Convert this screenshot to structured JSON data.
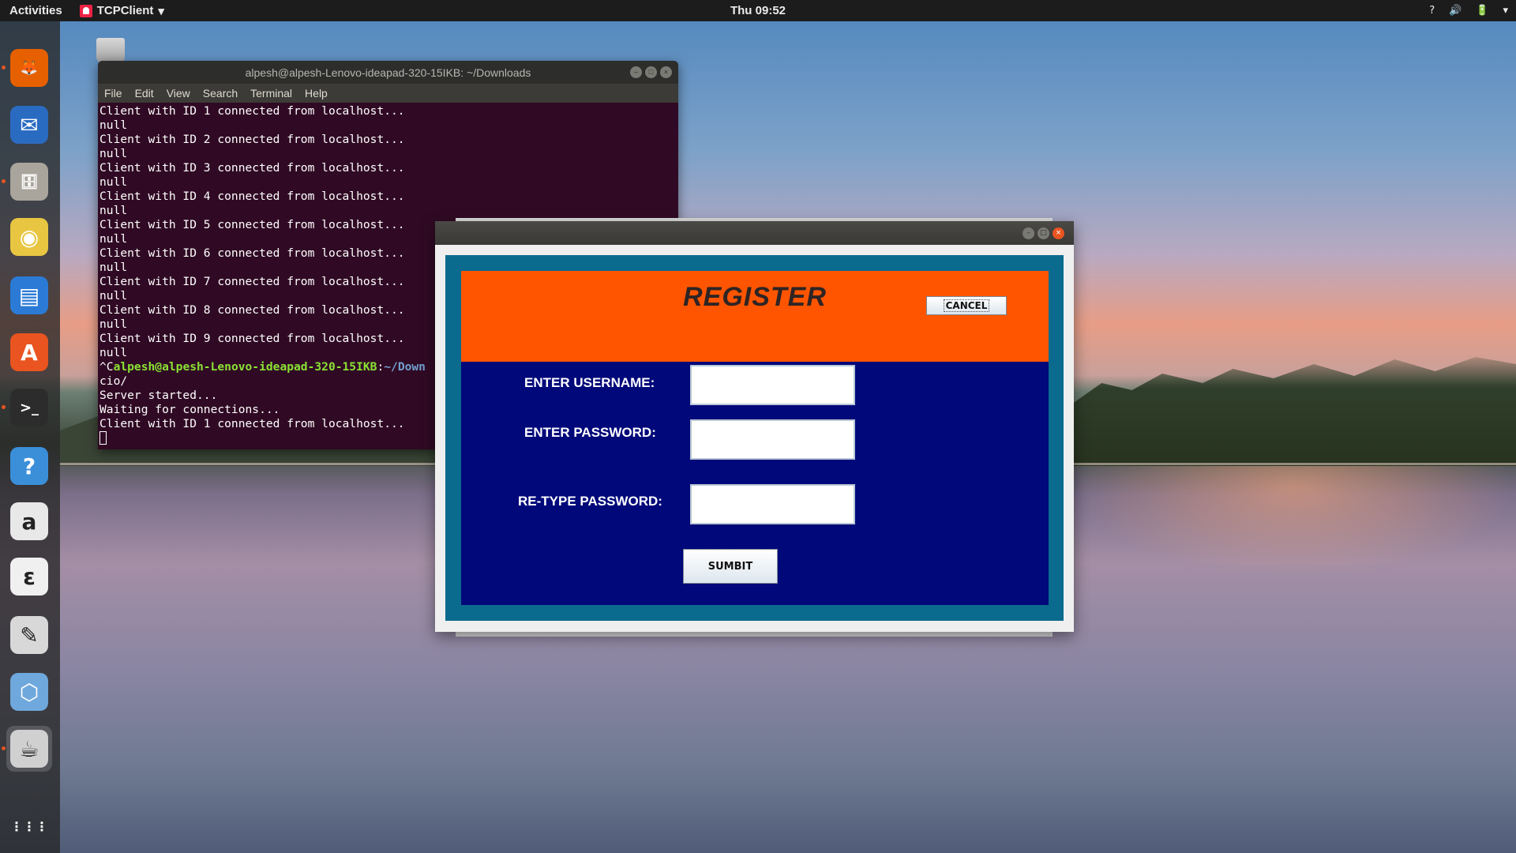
{
  "topbar": {
    "activities": "Activities",
    "app_name": "TCPClient",
    "app_menu_arrow": "▾",
    "clock": "Thu 09:52",
    "status_icons": [
      "?",
      "🔊",
      "🔋",
      "▾"
    ]
  },
  "dock": {
    "items": [
      {
        "name": "firefox-icon",
        "glyph": "🦊",
        "bg": "#e66000"
      },
      {
        "name": "thunderbird-icon",
        "glyph": "✉",
        "bg": "#2a6bc2"
      },
      {
        "name": "files-icon",
        "glyph": "🗄",
        "bg": "#a9a59c"
      },
      {
        "name": "rhythmbox-icon",
        "glyph": "◉",
        "bg": "#e8c642"
      },
      {
        "name": "libreoffice-writer-icon",
        "glyph": "▤",
        "bg": "#2b7bd6"
      },
      {
        "name": "software-center-icon",
        "glyph": "A",
        "bg": "#e95420"
      },
      {
        "name": "terminal-icon",
        "glyph": ">_",
        "bg": "#2c2c2c"
      },
      {
        "name": "help-icon",
        "glyph": "?",
        "bg": "#3b8fd9"
      },
      {
        "name": "amazon-icon",
        "glyph": "a",
        "bg": "#e8e8e8"
      },
      {
        "name": "acrobat-reader-icon",
        "glyph": "ε",
        "bg": "#f0f0f0"
      },
      {
        "name": "text-editor-icon",
        "glyph": "✎",
        "bg": "#d8d8d8"
      },
      {
        "name": "virtualbox-icon",
        "glyph": "⬡",
        "bg": "#6fa8dc"
      },
      {
        "name": "java-app-icon",
        "glyph": "☕",
        "bg": "#d0d0d0"
      }
    ],
    "show_apps_glyph": "⋮⋮⋮"
  },
  "terminal": {
    "title": "alpesh@alpesh-Lenovo-ideapad-320-15IKB: ~/Downloads",
    "menu": [
      "File",
      "Edit",
      "View",
      "Search",
      "Terminal",
      "Help"
    ],
    "lines_before_prompt": [
      "Client with ID 1 connected from localhost...",
      "null",
      "Client with ID 2 connected from localhost...",
      "null",
      "Client with ID 3 connected from localhost...",
      "null",
      "Client with ID 4 connected from localhost...",
      "null",
      "Client with ID 5 connected from localhost...",
      "null",
      "Client with ID 6 connected from localhost...",
      "null",
      "Client with ID 7 connected from localhost...",
      "null",
      "Client with ID 8 connected from localhost...",
      "null",
      "Client with ID 9 connected from localhost...",
      "null"
    ],
    "prompt_prefix": "^C",
    "prompt_user": "alpesh@alpesh-Lenovo-ideapad-320-15IKB",
    "prompt_sep": ":",
    "prompt_path": "~/Down",
    "lines_after_prompt": [
      "cio/",
      "Server started...",
      "Waiting for connections...",
      "Client with ID 1 connected from localhost..."
    ]
  },
  "register": {
    "title": "REGISTER",
    "cancel_label": "CANCEL",
    "username_label": "ENTER USERNAME:",
    "password_label": "ENTER PASSWORD:",
    "retype_label": "RE-TYPE PASSWORD:",
    "username_value": "",
    "password_value": "",
    "retype_value": "",
    "submit_label": "SUMBIT"
  },
  "colors": {
    "register_header": "#ff5500",
    "register_form": "#00087a",
    "register_border": "#0a6b8f",
    "terminal_bg": "#300a24",
    "ubuntu_orange": "#e95420"
  }
}
